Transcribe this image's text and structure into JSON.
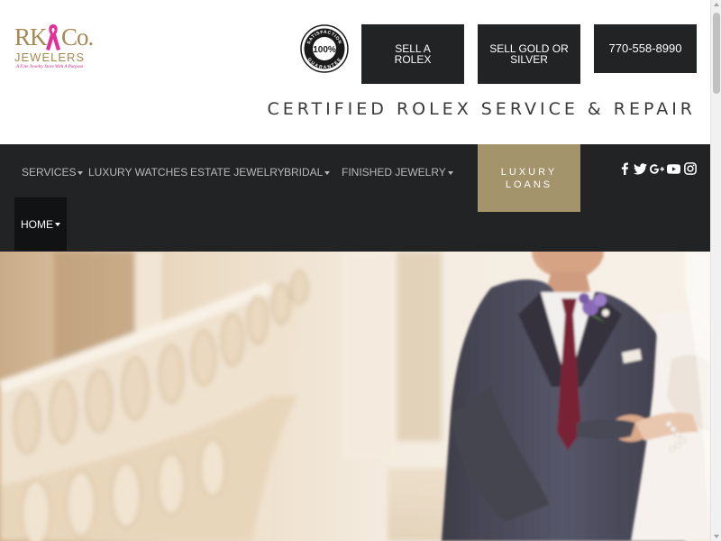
{
  "header": {
    "logo": {
      "rk": "RK",
      "co": "Co.",
      "jewelers": "JEWELERS",
      "tagline": "A Fine Jewelry Store With A Purpose",
      "ribbon_color": "#e0309a"
    },
    "badge": {
      "top_text": "SATISFACTION",
      "center_text": "100%",
      "bottom_text": "GUARANTEE"
    },
    "buttons": {
      "sell_rolex_line1": "SELL A",
      "sell_rolex_line2": "ROLEX",
      "sell_gold_line1": "SELL GOLD OR",
      "sell_gold_line2": "SILVER",
      "phone": "770-558-8990"
    },
    "tagline": "CERTIFIED ROLEX SERVICE & REPAIR"
  },
  "nav": {
    "items": [
      {
        "label": "SERVICES",
        "dropdown": true
      },
      {
        "label": "LUXURY WATCHES",
        "dropdown": false
      },
      {
        "label": "ESTATE JEWELRY",
        "dropdown": false
      },
      {
        "label": "BRIDAL",
        "dropdown": true
      },
      {
        "label": "FINISHED JEWELRY",
        "dropdown": true
      }
    ],
    "home": "HOME",
    "loans_line1": "LUXURY",
    "loans_line2": "LOANS",
    "social": [
      "facebook-icon",
      "twitter-icon",
      "google-plus-icon",
      "youtube-icon",
      "instagram-icon"
    ]
  },
  "colors": {
    "brand_gold": "#a48a55",
    "nav_bg": "#222325",
    "loans_bg": "#a4946c",
    "ribbon_pink": "#e0309a"
  }
}
